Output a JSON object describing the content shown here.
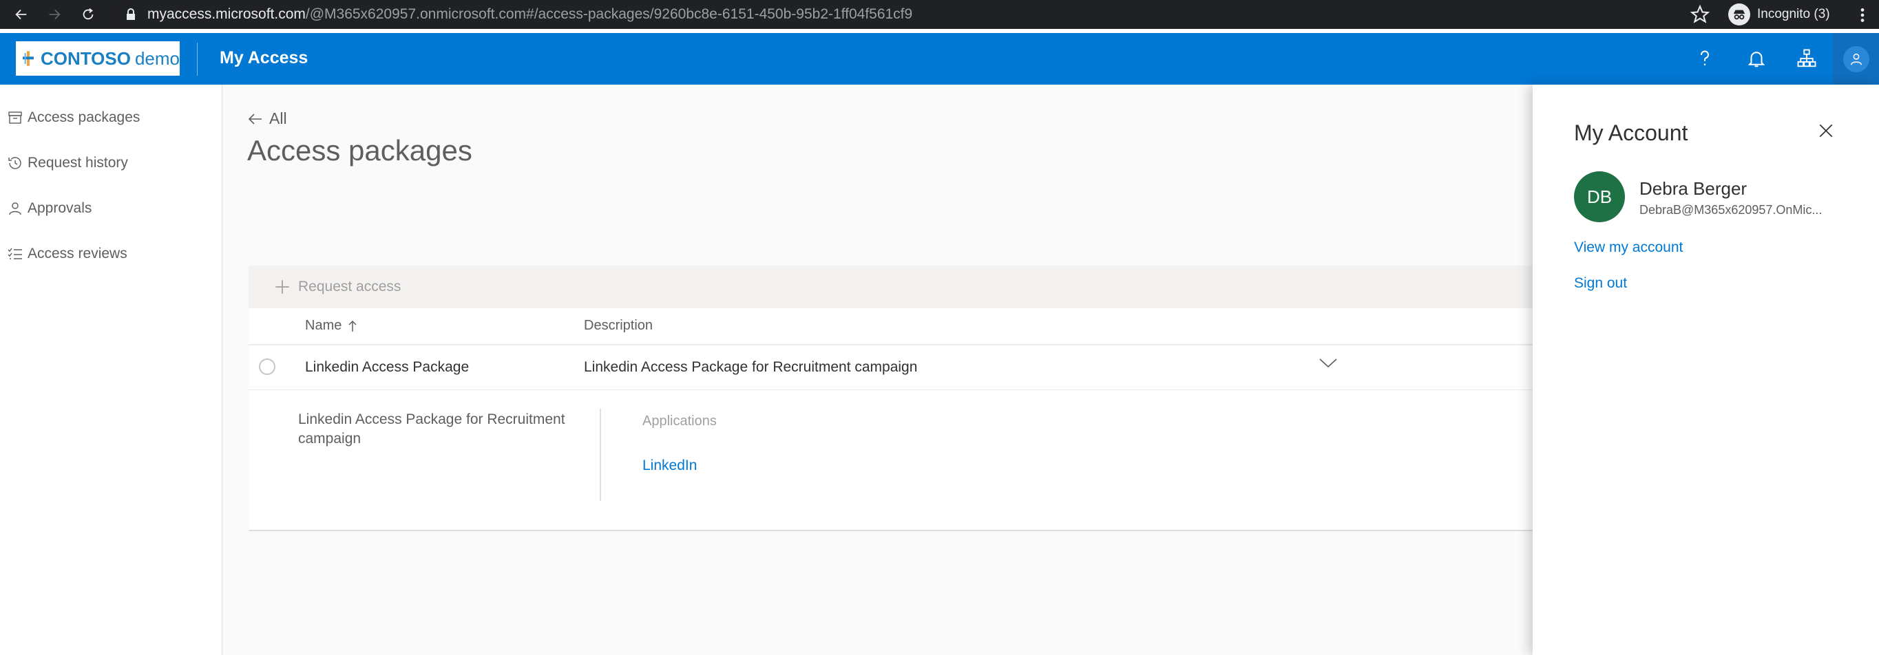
{
  "browser": {
    "url_host": "myaccess.microsoft.com",
    "url_path": "/@M365x620957.onmicrosoft.com#/access-packages/9260bc8e-6151-450b-95b2-1ff04f561cf9",
    "profile_label": "Incognito (3)"
  },
  "header": {
    "logo_brand": "CONTOSO",
    "logo_suffix": "demo",
    "app_title": "My Access",
    "accent_color": "#0078d4"
  },
  "sidebar": {
    "items": [
      {
        "label": "Access packages",
        "icon": "package-icon"
      },
      {
        "label": "Request history",
        "icon": "history-icon"
      },
      {
        "label": "Approvals",
        "icon": "person-icon"
      },
      {
        "label": "Access reviews",
        "icon": "checklist-icon"
      }
    ]
  },
  "main": {
    "back_label": "All",
    "title": "Access packages",
    "request_access_label": "Request access",
    "columns": {
      "name": "Name",
      "description": "Description"
    },
    "rows": [
      {
        "name": "Linkedin Access Package",
        "description": "Linkedin Access Package for Recruitment campaign"
      }
    ],
    "detail": {
      "description": "Linkedin Access Package for Recruitment campaign",
      "applications_label": "Applications",
      "applications": [
        "LinkedIn"
      ]
    }
  },
  "account_panel": {
    "title": "My Account",
    "initials": "DB",
    "name": "Debra Berger",
    "email": "DebraB@M365x620957.OnMic...",
    "view_account_label": "View my account",
    "sign_out_label": "Sign out",
    "persona_color": "#1d7145"
  }
}
